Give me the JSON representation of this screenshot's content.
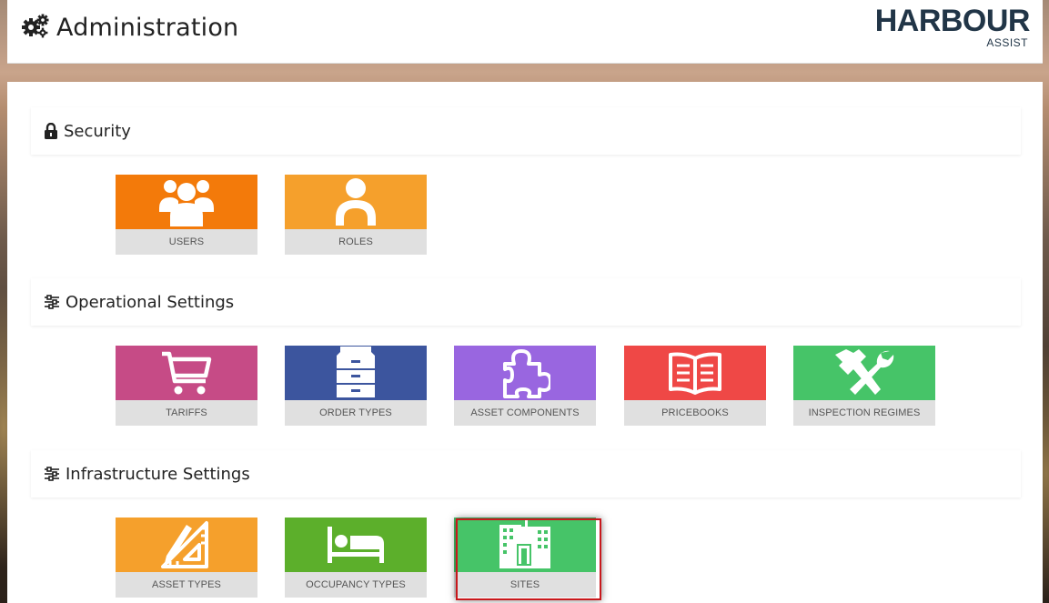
{
  "header": {
    "title": "Administration",
    "logo_word": "HARBOUR",
    "logo_sub": "ASSIST"
  },
  "sections": [
    {
      "label": "Security",
      "icon": "lock-icon",
      "tiles": [
        {
          "label": "USERS",
          "color": "#f37a0a",
          "icon": "users-icon"
        },
        {
          "label": "ROLES",
          "color": "#f5a02c",
          "icon": "user-icon"
        }
      ]
    },
    {
      "label": "Operational Settings",
      "icon": "sliders-icon",
      "tiles": [
        {
          "label": "TARIFFS",
          "color": "#c64b86",
          "icon": "cart-icon"
        },
        {
          "label": "ORDER TYPES",
          "color": "#3c559e",
          "icon": "drawers-icon"
        },
        {
          "label": "ASSET COMPONENTS",
          "color": "#9966e0",
          "icon": "puzzle-icon"
        },
        {
          "label": "PRICEBOOKS",
          "color": "#ef4846",
          "icon": "book-icon"
        },
        {
          "label": "INSPECTION REGIMES",
          "color": "#46c468",
          "icon": "tools-icon"
        }
      ]
    },
    {
      "label": "Infrastructure Settings",
      "icon": "sliders-icon",
      "tiles": [
        {
          "label": "ASSET TYPES",
          "color": "#f5a02c",
          "icon": "drafting-icon"
        },
        {
          "label": "OCCUPANCY TYPES",
          "color": "#5caf2b",
          "icon": "bed-icon"
        },
        {
          "label": "SITES",
          "color": "#46c468",
          "icon": "building-icon"
        }
      ]
    }
  ]
}
